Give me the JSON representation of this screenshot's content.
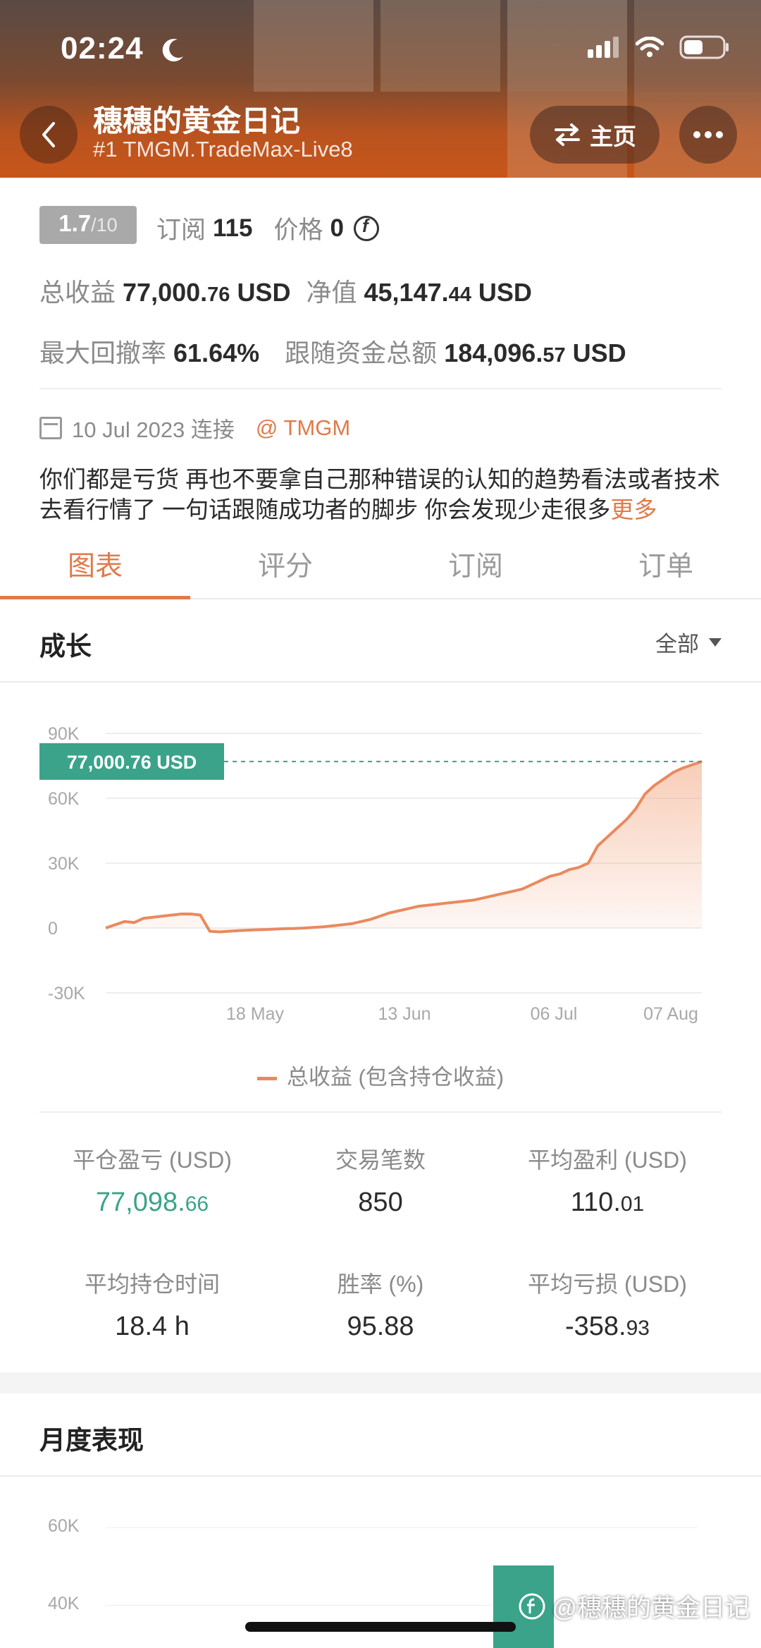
{
  "status": {
    "time": "02:24"
  },
  "header": {
    "title": "穗穗的黄金日记",
    "subtitle": "#1 TMGM.TradeMax-Live8",
    "home_label": "主页"
  },
  "info": {
    "rating_main": "1.7",
    "rating_denominator": "/10",
    "subscribe_label": "订阅",
    "subscribe_count": "115",
    "price_label": "价格",
    "price_value": "0",
    "total_profit_label": "总收益",
    "total_profit_int": "77,000.",
    "total_profit_dec": "76",
    "total_profit_unit": "USD",
    "equity_label": "净值",
    "equity_int": "45,147.",
    "equity_dec": "44",
    "equity_unit": "USD",
    "max_drawdown_label": "最大回撤率",
    "max_drawdown_value": "61.64%",
    "follow_funds_label": "跟随资金总额",
    "follow_funds_int": "184,096.",
    "follow_funds_dec": "57",
    "follow_funds_unit": "USD",
    "connect_date": "10 Jul 2023 连接",
    "broker": "@ TMGM",
    "description": "你们都是亏货 再也不要拿自己那种错误的认知的趋势看法或者技术去看行情了 一句话跟随成功者的脚步 你会发现少走很多",
    "more_label": "更多"
  },
  "tabs": [
    "图表",
    "评分",
    "订阅",
    "订单"
  ],
  "growth": {
    "title": "成长",
    "range": "全部",
    "legend": "总收益 (包含持仓收益)"
  },
  "chart_data": {
    "type": "area",
    "ylim": [
      -30000,
      90000
    ],
    "y_ticks": [
      "90K",
      "60K",
      "30K",
      "0",
      "-30K"
    ],
    "x_ticks": [
      "18 May",
      "13 Jun",
      "06 Jul",
      "07 Aug"
    ],
    "current_label": "77,000.76 USD",
    "current_value": 77000.76,
    "line_color": "#e88a5f",
    "series": [
      {
        "name": "总收益 (包含持仓收益)",
        "values": [
          0,
          1500,
          3000,
          2500,
          4500,
          5000,
          5500,
          6000,
          6500,
          6500,
          6000,
          -1500,
          -1800,
          -1500,
          -1200,
          -1000,
          -800,
          -700,
          -500,
          -300,
          -200,
          0,
          300,
          600,
          1000,
          1500,
          2000,
          3000,
          4000,
          5500,
          7000,
          8000,
          9000,
          10000,
          10500,
          11000,
          11500,
          12000,
          12500,
          13000,
          14000,
          15000,
          16000,
          17000,
          18000,
          20000,
          22000,
          24000,
          25000,
          27000,
          28000,
          30000,
          38000,
          42000,
          46000,
          50000,
          55000,
          62000,
          66000,
          69000,
          72000,
          74000,
          75500,
          77000
        ]
      }
    ]
  },
  "stats": [
    {
      "label": "平仓盈亏 (USD)",
      "int": "77,098.",
      "dec": "66",
      "green": true
    },
    {
      "label": "交易笔数",
      "int": "850",
      "dec": ""
    },
    {
      "label": "平均盈利 (USD)",
      "int": "110.",
      "dec": "01"
    },
    {
      "label": "平均持仓时间",
      "int": "18.4 h",
      "dec": ""
    },
    {
      "label": "胜率 (%)",
      "int": "95.88",
      "dec": ""
    },
    {
      "label": "平均亏损 (USD)",
      "int": "-358.",
      "dec": "93"
    }
  ],
  "monthly": {
    "title": "月度表现",
    "y_ticks": [
      "60K",
      "40K"
    ]
  },
  "watermark": "@穗穗的黄金日记",
  "colors": {
    "accent": "#e07a4a",
    "green": "#3aa38a"
  }
}
